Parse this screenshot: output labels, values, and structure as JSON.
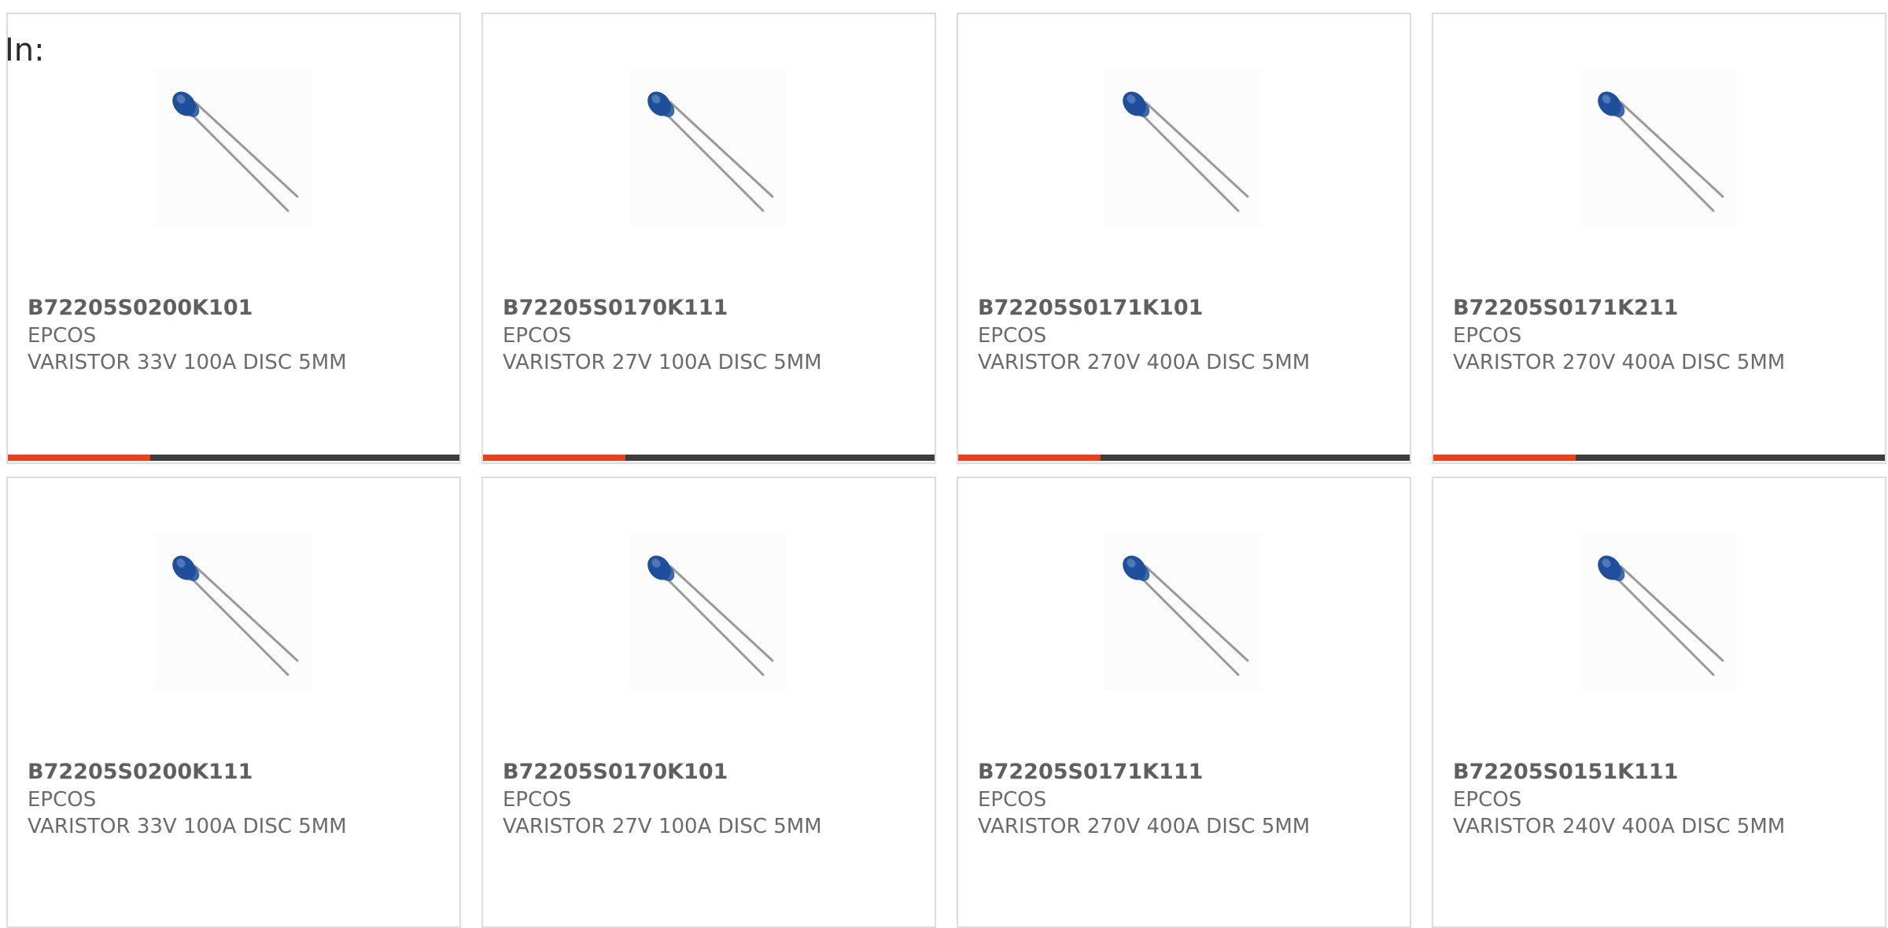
{
  "header": {
    "label": "In:"
  },
  "colors": {
    "accent": "#e8411b",
    "bar_track": "#3d3d3d",
    "varistor_blue": "#1f4f9a"
  },
  "products": [
    {
      "part_number": "B72205S0200K101",
      "manufacturer": "EPCOS",
      "description": "VARISTOR 33V 100A DISC 5MM",
      "image_icon": "varistor-image"
    },
    {
      "part_number": "B72205S0170K111",
      "manufacturer": "EPCOS",
      "description": "VARISTOR 27V 100A DISC 5MM",
      "image_icon": "varistor-image"
    },
    {
      "part_number": "B72205S0171K101",
      "manufacturer": "EPCOS",
      "description": "VARISTOR 270V 400A DISC 5MM",
      "image_icon": "varistor-image"
    },
    {
      "part_number": "B72205S0171K211",
      "manufacturer": "EPCOS",
      "description": "VARISTOR 270V 400A DISC 5MM",
      "image_icon": "varistor-image"
    },
    {
      "part_number": "B72205S0200K111",
      "manufacturer": "EPCOS",
      "description": "VARISTOR 33V 100A DISC 5MM",
      "image_icon": "varistor-image"
    },
    {
      "part_number": "B72205S0170K101",
      "manufacturer": "EPCOS",
      "description": "VARISTOR 27V 100A DISC 5MM",
      "image_icon": "varistor-image"
    },
    {
      "part_number": "B72205S0171K111",
      "manufacturer": "EPCOS",
      "description": "VARISTOR 270V 400A DISC 5MM",
      "image_icon": "varistor-image"
    },
    {
      "part_number": "B72205S0151K111",
      "manufacturer": "EPCOS",
      "description": "VARISTOR 240V 400A DISC 5MM",
      "image_icon": "varistor-image"
    }
  ],
  "progress_fraction": 0.315
}
